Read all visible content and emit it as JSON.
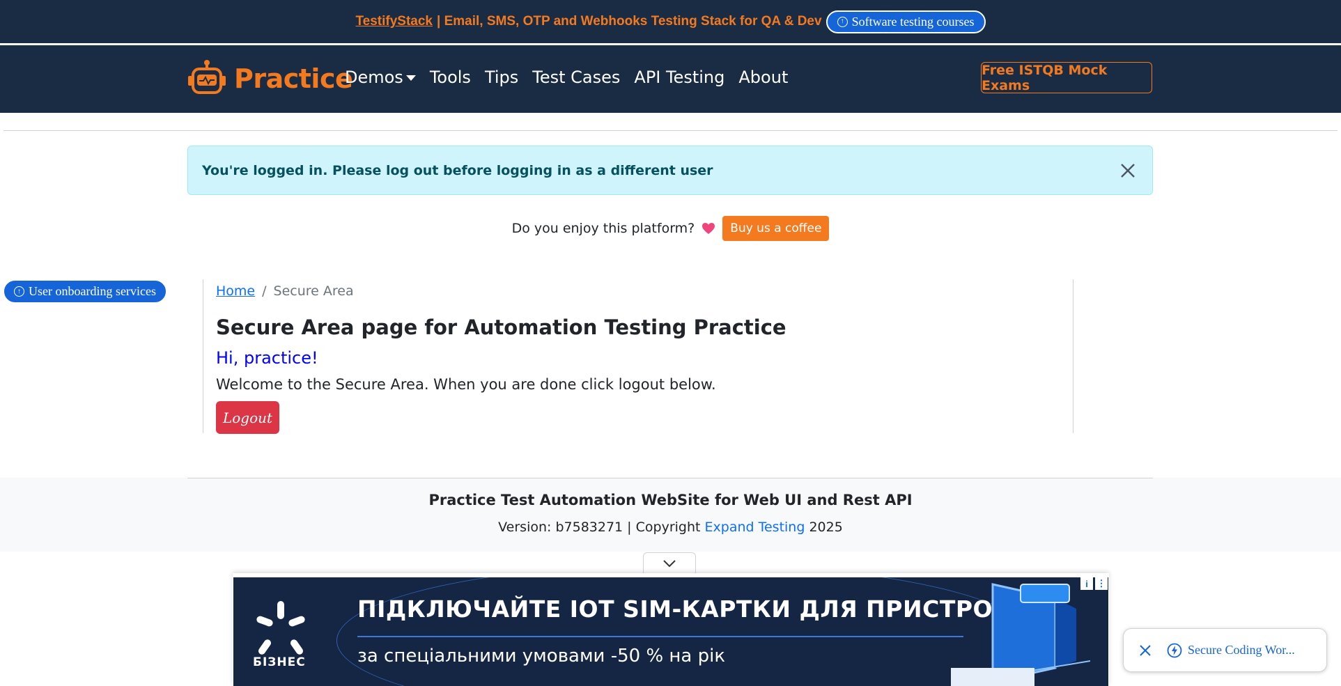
{
  "promo": {
    "brand_link": "TestifyStack",
    "text": "| Email, SMS, OTP and Webhooks Testing Stack for QA & Dev",
    "courses_button": "Software testing courses"
  },
  "nav": {
    "brand": "Practice",
    "links": [
      "Demos",
      "Tools",
      "Tips",
      "Test Cases",
      "API Testing",
      "About"
    ],
    "istqb_button": "Free ISTQB Mock Exams"
  },
  "alert": {
    "message": "You're logged in. Please log out before logging in as a different user"
  },
  "enjoy": {
    "text": "Do you enjoy this platform?",
    "coffee_button": "Buy us a coffee"
  },
  "side": {
    "onboarding_button": "User onboarding services"
  },
  "main": {
    "breadcrumb_home": "Home",
    "breadcrumb_sep": "/",
    "breadcrumb_current": "Secure Area",
    "title": "Secure Area page for Automation Testing Practice",
    "greeting": "Hi, practice!",
    "welcome": "Welcome to the Secure Area. When you are done click logout below.",
    "logout_button": "Logout"
  },
  "footer": {
    "title": "Practice Test Automation WebSite for Web UI and Rest API",
    "version_prefix": "Version: b7583271 | Copyright",
    "company": "Expand Testing",
    "year": "2025"
  },
  "ad": {
    "logo_text": "БІЗНЕС",
    "headline": "ПІДКЛЮЧАЙТЕ IOT SIM-КАРТКИ ДЛЯ ПРИСТРОЇВ",
    "subline": "за спеціальними умовами -50 % на рік",
    "info_icon": "i",
    "menu_icon": "⋮"
  },
  "toast": {
    "link_text": "Secure Coding Wor..."
  },
  "colors": {
    "navy": "#1a2b44",
    "orange": "#f47a20",
    "alert_bg": "#cff4fc",
    "danger": "#dc3545",
    "link_blue": "#0d6efd"
  }
}
